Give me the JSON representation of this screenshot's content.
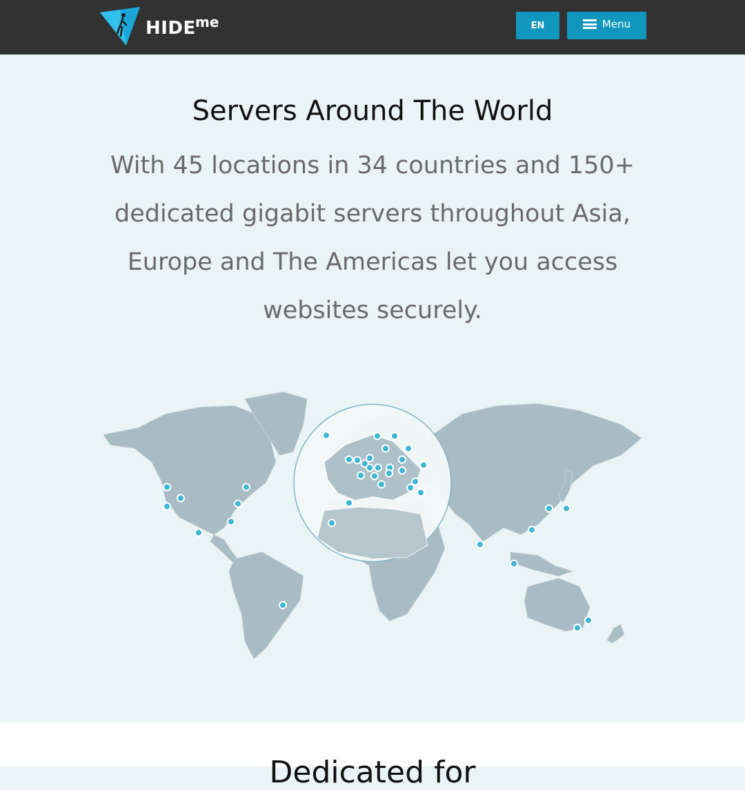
{
  "header": {
    "logo_text": "HIDE",
    "logo_suffix": "me",
    "lang_label": "EN",
    "menu_label": "Menu"
  },
  "hero": {
    "title": "Servers Around The World",
    "description": "With 45 locations in 34 countries and 150+ dedicated gigabit servers throughout Asia, Europe and The Americas let you access websites securely."
  },
  "next_section": {
    "heading": "Dedicated for"
  },
  "colors": {
    "header_bg": "#323232",
    "accent": "#1196bd",
    "page_bg": "#eaf3f5",
    "server_dot": "#3fb6d3",
    "land": "#a9bcc4"
  },
  "icons": {
    "logo": "hide-me-triangle-logo-icon",
    "menu": "hamburger-menu-icon"
  }
}
